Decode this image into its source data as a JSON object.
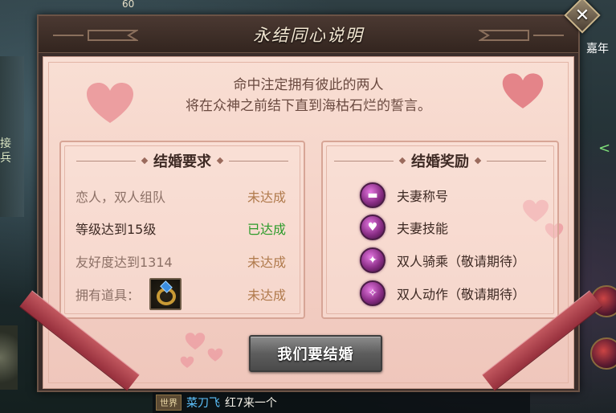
{
  "background": {
    "top_number": "60",
    "left_chars": [
      "接",
      "兵"
    ],
    "right_label": "嘉年",
    "right_fragment": "<"
  },
  "dialog": {
    "title": "永结同心说明",
    "intro_lines": [
      "命中注定拥有彼此的两人",
      "将在众神之前结下直到海枯石烂的誓言。"
    ],
    "requirements": {
      "title": "结婚要求",
      "rows": [
        {
          "label": "恋人，双人组队",
          "status": "未达成",
          "done": false
        },
        {
          "label": "等级达到15级",
          "status": "已达成",
          "done": true
        },
        {
          "label": "友好度达到1314",
          "status": "未达成",
          "done": false
        },
        {
          "label": "拥有道具：",
          "status": "未达成",
          "done": false,
          "item_icon": "wedding-ring-icon"
        }
      ]
    },
    "rewards": {
      "title": "结婚奖励",
      "rows": [
        {
          "label": "夫妻称号",
          "icon": "title-badge-icon"
        },
        {
          "label": "夫妻技能",
          "icon": "hearts-skill-icon"
        },
        {
          "label": "双人骑乘（敬请期待）",
          "icon": "wings-mount-icon"
        },
        {
          "label": "双人动作（敬请期待）",
          "icon": "bow-action-icon"
        }
      ]
    },
    "action_button": "我们要结婚"
  },
  "chat": {
    "channel": "世界",
    "sender": "菜刀飞",
    "message": "红7来一个"
  },
  "colors": {
    "panel_bg": "#f6d8cd",
    "done_green": "#2c9b2a",
    "pending_orange": "#b07a4c",
    "ribbon_red": "#b2434b"
  }
}
